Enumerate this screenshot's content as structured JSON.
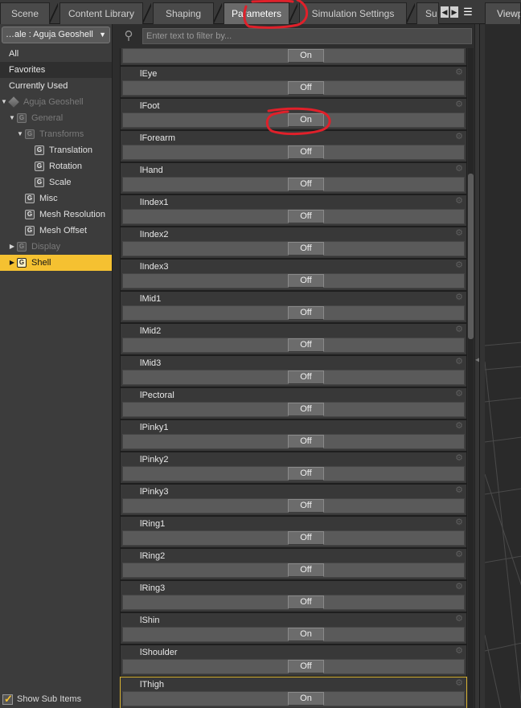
{
  "tabs": [
    {
      "label": "Scene",
      "active": false
    },
    {
      "label": "Content Library",
      "active": false
    },
    {
      "label": "Shaping",
      "active": false
    },
    {
      "label": "Parameters",
      "active": true
    },
    {
      "label": "Simulation Settings",
      "active": false
    },
    {
      "label": "Su",
      "active": false
    }
  ],
  "viewport_tab": "Viewp",
  "tab_arrows": {
    "left": "◀",
    "right": "▶"
  },
  "menu_icon": "☰",
  "left_panel": {
    "node_selector": "…ale : Aguja Geoshell",
    "categories": [
      {
        "label": "All"
      },
      {
        "label": "Favorites"
      },
      {
        "label": "Currently Used"
      }
    ],
    "tree": [
      {
        "label": "Aguja Geoshell",
        "icon": "cube-icon",
        "level": 0,
        "expanded": true,
        "dim": true,
        "selected": false
      },
      {
        "label": "General",
        "icon": "group-icon",
        "level": 1,
        "expanded": true,
        "dim": true,
        "selected": false
      },
      {
        "label": "Transforms",
        "icon": "group-icon",
        "level": 2,
        "expanded": true,
        "dim": true,
        "selected": false
      },
      {
        "label": "Translation",
        "icon": "group-icon",
        "level": 3,
        "expanded": null,
        "dim": false,
        "selected": false
      },
      {
        "label": "Rotation",
        "icon": "group-icon",
        "level": 3,
        "expanded": null,
        "dim": false,
        "selected": false
      },
      {
        "label": "Scale",
        "icon": "group-icon",
        "level": 3,
        "expanded": null,
        "dim": false,
        "selected": false
      },
      {
        "label": "Misc",
        "icon": "group-icon",
        "level": 2,
        "expanded": null,
        "dim": false,
        "selected": false
      },
      {
        "label": "Mesh Resolution",
        "icon": "group-icon",
        "level": 2,
        "expanded": null,
        "dim": false,
        "selected": false
      },
      {
        "label": "Mesh Offset",
        "icon": "group-icon",
        "level": 2,
        "expanded": null,
        "dim": false,
        "selected": false
      },
      {
        "label": "Display",
        "icon": "group-icon",
        "level": 1,
        "expanded": false,
        "dim": true,
        "selected": false
      },
      {
        "label": "Shell",
        "icon": "group-icon",
        "level": 1,
        "expanded": false,
        "dim": false,
        "selected": true
      }
    ],
    "show_sub_items": {
      "label": "Show Sub Items",
      "checked": true
    }
  },
  "filter": {
    "placeholder": "Enter text to filter by..."
  },
  "params": [
    {
      "name": "",
      "value": "On",
      "highlighted": false
    },
    {
      "name": "lEye",
      "value": "Off",
      "highlighted": false
    },
    {
      "name": "lFoot",
      "value": "On",
      "highlighted": false
    },
    {
      "name": "lForearm",
      "value": "Off",
      "highlighted": false
    },
    {
      "name": "lHand",
      "value": "Off",
      "highlighted": false
    },
    {
      "name": "lIndex1",
      "value": "Off",
      "highlighted": false
    },
    {
      "name": "lIndex2",
      "value": "Off",
      "highlighted": false
    },
    {
      "name": "lIndex3",
      "value": "Off",
      "highlighted": false
    },
    {
      "name": "lMid1",
      "value": "Off",
      "highlighted": false
    },
    {
      "name": "lMid2",
      "value": "Off",
      "highlighted": false
    },
    {
      "name": "lMid3",
      "value": "Off",
      "highlighted": false
    },
    {
      "name": "lPectoral",
      "value": "Off",
      "highlighted": false
    },
    {
      "name": "lPinky1",
      "value": "Off",
      "highlighted": false
    },
    {
      "name": "lPinky2",
      "value": "Off",
      "highlighted": false
    },
    {
      "name": "lPinky3",
      "value": "Off",
      "highlighted": false
    },
    {
      "name": "lRing1",
      "value": "Off",
      "highlighted": false
    },
    {
      "name": "lRing2",
      "value": "Off",
      "highlighted": false
    },
    {
      "name": "lRing3",
      "value": "Off",
      "highlighted": false
    },
    {
      "name": "lShin",
      "value": "On",
      "highlighted": false
    },
    {
      "name": "lShoulder",
      "value": "Off",
      "highlighted": false
    },
    {
      "name": "lThigh",
      "value": "On",
      "highlighted": true
    }
  ],
  "colors": {
    "selection": "#f5c131",
    "annotation": "#e0202a",
    "panel_bg": "#2d2d2d"
  }
}
